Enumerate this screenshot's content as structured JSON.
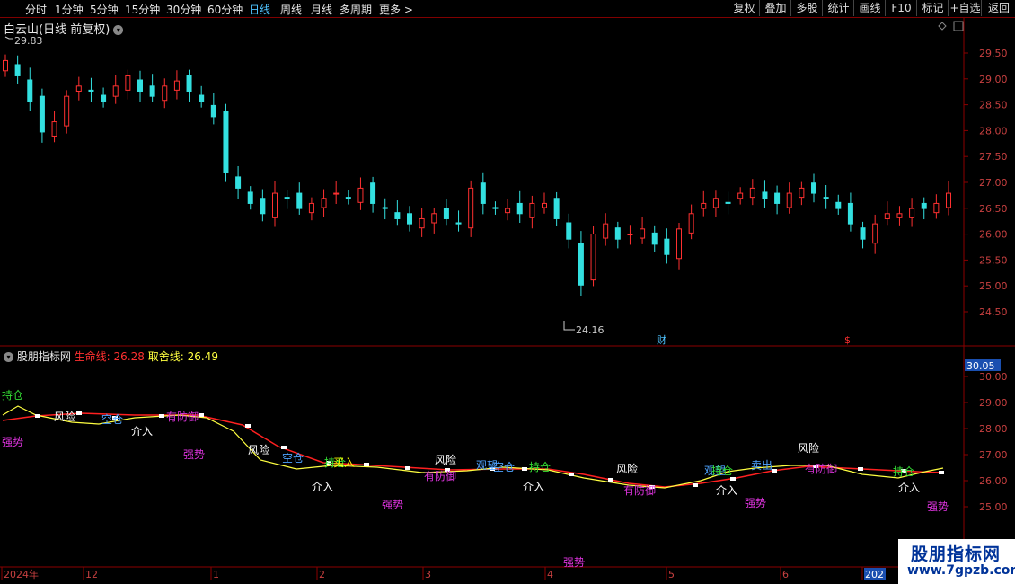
{
  "toolbar": {
    "periods": [
      "分时",
      "1分钟",
      "5分钟",
      "15分钟",
      "30分钟",
      "60分钟",
      "日线",
      "周线",
      "月线",
      "多周期",
      "更多 >"
    ],
    "active": "日线",
    "right_buttons": [
      "复权",
      "叠加",
      "多股",
      "统计",
      "画线",
      "F10",
      "标记",
      "+自选",
      "返回"
    ]
  },
  "stock": {
    "title": "白云山(日线 前复权)",
    "high_label": "29.83",
    "low_label": "24.16"
  },
  "price_axis": [
    "29.50",
    "29.00",
    "28.50",
    "28.00",
    "27.50",
    "27.00",
    "26.50",
    "26.00",
    "25.50",
    "25.00",
    "24.50"
  ],
  "indicator": {
    "name": "股朋指标网",
    "life_line_label": "生命线:",
    "life_line_value": "26.28",
    "choice_line_label": "取舍线:",
    "choice_line_value": "26.49",
    "axis": [
      "30.05",
      "30.00",
      "29.00",
      "28.00",
      "27.00",
      "26.00",
      "25.00"
    ]
  },
  "signals": [
    {
      "text": "持仓",
      "color": "#33dd33"
    },
    {
      "text": "强势",
      "color": "#dd33dd"
    },
    {
      "text": "风险",
      "color": "#ffffff"
    },
    {
      "text": "空仓",
      "color": "#4ea3ff"
    },
    {
      "text": "介入",
      "color": "#ffffff"
    },
    {
      "text": "有防御",
      "color": "#dd33dd"
    },
    {
      "text": "强势",
      "color": "#dd33dd"
    },
    {
      "text": "风险",
      "color": "#ffffff"
    },
    {
      "text": "空仓",
      "color": "#4ea3ff"
    },
    {
      "text": "持仓",
      "color": "#33dd33"
    },
    {
      "text": "买入",
      "color": "#ffff00"
    },
    {
      "text": "介入",
      "color": "#ffffff"
    },
    {
      "text": "强势",
      "color": "#dd33dd"
    },
    {
      "text": "风险",
      "color": "#ffffff"
    },
    {
      "text": "有防御",
      "color": "#dd33dd"
    },
    {
      "text": "观望",
      "color": "#4ea3ff"
    },
    {
      "text": "空仓",
      "color": "#4ea3ff"
    },
    {
      "text": "持仓",
      "color": "#33dd33"
    },
    {
      "text": "介入",
      "color": "#ffffff"
    },
    {
      "text": "强势",
      "color": "#dd33dd"
    },
    {
      "text": "风险",
      "color": "#ffffff"
    },
    {
      "text": "有防御",
      "color": "#dd33dd"
    },
    {
      "text": "观望",
      "color": "#4ea3ff"
    },
    {
      "text": "持仓",
      "color": "#33dd33"
    },
    {
      "text": "介入",
      "color": "#ffffff"
    },
    {
      "text": "强势",
      "color": "#dd33dd"
    },
    {
      "text": "卖出",
      "color": "#4ea3ff"
    },
    {
      "text": "风险",
      "color": "#ffffff"
    },
    {
      "text": "有防御",
      "color": "#dd33dd"
    },
    {
      "text": "持仓",
      "color": "#33dd33"
    },
    {
      "text": "介入",
      "color": "#ffffff"
    },
    {
      "text": "强势",
      "color": "#dd33dd"
    }
  ],
  "markers": {
    "fin": "财",
    "dollar": "$"
  },
  "time_axis": [
    "2024年",
    "12",
    "1",
    "2",
    "3",
    "4",
    "5",
    "6",
    "202"
  ],
  "watermark": {
    "name": "股朋指标网",
    "url": "www.7gpzb.com"
  },
  "colors": {
    "up": "#ff3030",
    "down": "#33e0e0",
    "grid": "#8b0000",
    "life": "#ff2020",
    "choice": "#ffff40"
  },
  "chart_data": {
    "type": "candlestick",
    "price_range": [
      24.16,
      29.83
    ],
    "closes": [
      29.4,
      29.1,
      28.6,
      28.0,
      28.2,
      28.7,
      28.9,
      28.8,
      28.6,
      28.9,
      29.1,
      28.8,
      28.7,
      28.9,
      29.0,
      28.8,
      28.6,
      28.3,
      27.2,
      26.9,
      26.6,
      26.4,
      26.8,
      26.7,
      26.5,
      26.6,
      26.7,
      26.8,
      26.7,
      26.9,
      26.6,
      26.5,
      26.3,
      26.2,
      26.3,
      26.4,
      26.3,
      26.2,
      26.9,
      26.6,
      26.5,
      26.5,
      26.4,
      26.6,
      26.6,
      26.3,
      25.9,
      25.0,
      26.0,
      26.2,
      25.9,
      26.0,
      26.1,
      25.8,
      25.6,
      26.1,
      26.4,
      26.6,
      26.7,
      26.6,
      26.8,
      26.9,
      26.7,
      26.6,
      26.8,
      26.9,
      26.8,
      26.7,
      26.5,
      26.2,
      25.9,
      26.2,
      26.4,
      26.4,
      26.5,
      26.5,
      26.6,
      26.8
    ]
  }
}
